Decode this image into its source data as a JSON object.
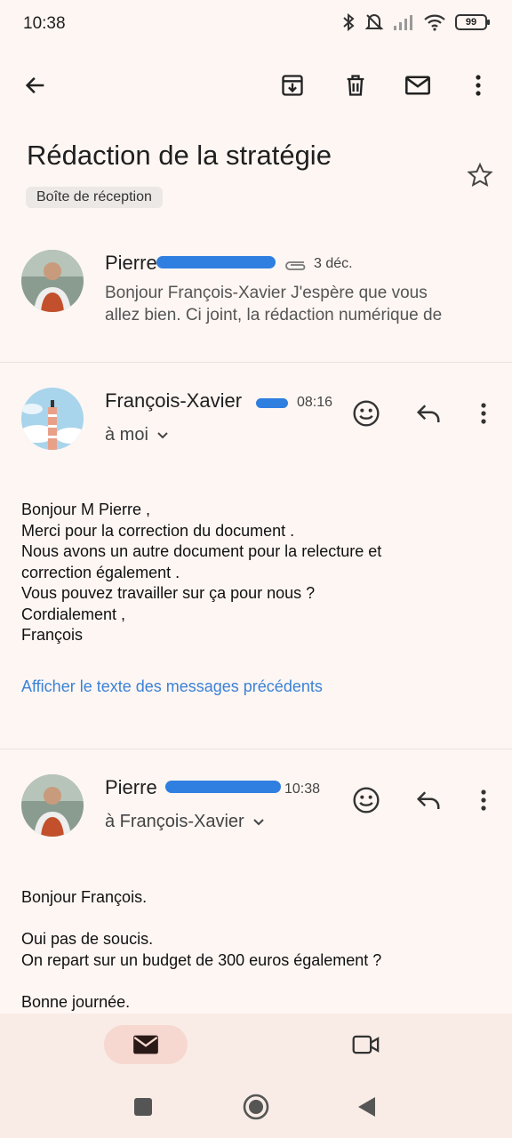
{
  "status": {
    "time": "10:38",
    "battery": "99"
  },
  "thread": {
    "subject": "Rédaction de la stratégie",
    "label": "Boîte de réception"
  },
  "messages": [
    {
      "sender": "Pierre",
      "time": "3 déc.",
      "snippet_line1": "Bonjour François-Xavier J'espère que vous",
      "snippet_line2": "allez bien. Ci joint, la rédaction numérique de"
    },
    {
      "sender": "François-Xavier",
      "time": "08:16",
      "recipient": "à moi",
      "body": [
        "Bonjour M Pierre ,",
        "Merci pour la correction du document .",
        "Nous avons un autre document pour la relecture et",
        "correction également .",
        "Vous pouvez travailler sur ça pour nous ?",
        "Cordialement ,",
        "François"
      ],
      "show_quoted": "Afficher le texte des messages précédents"
    },
    {
      "sender": "Pierre",
      "time": "10:38",
      "recipient": "à François-Xavier",
      "body": [
        "Bonjour François.",
        "",
        "Oui pas de soucis.",
        "On repart sur un budget de 300 euros également ?",
        "",
        "Bonne journée."
      ]
    }
  ],
  "colors": {
    "accent": "#3b82d6",
    "background": "#fdf6f3",
    "nav_active": "#f6d8d0"
  },
  "icons": [
    "back-arrow-icon",
    "archive-icon",
    "delete-icon",
    "mail-icon",
    "more-vert-icon",
    "star-icon",
    "attachment-icon",
    "emoji-icon",
    "reply-icon",
    "chevron-down-icon",
    "video-icon",
    "square-icon",
    "circle-icon",
    "triangle-back-icon"
  ]
}
